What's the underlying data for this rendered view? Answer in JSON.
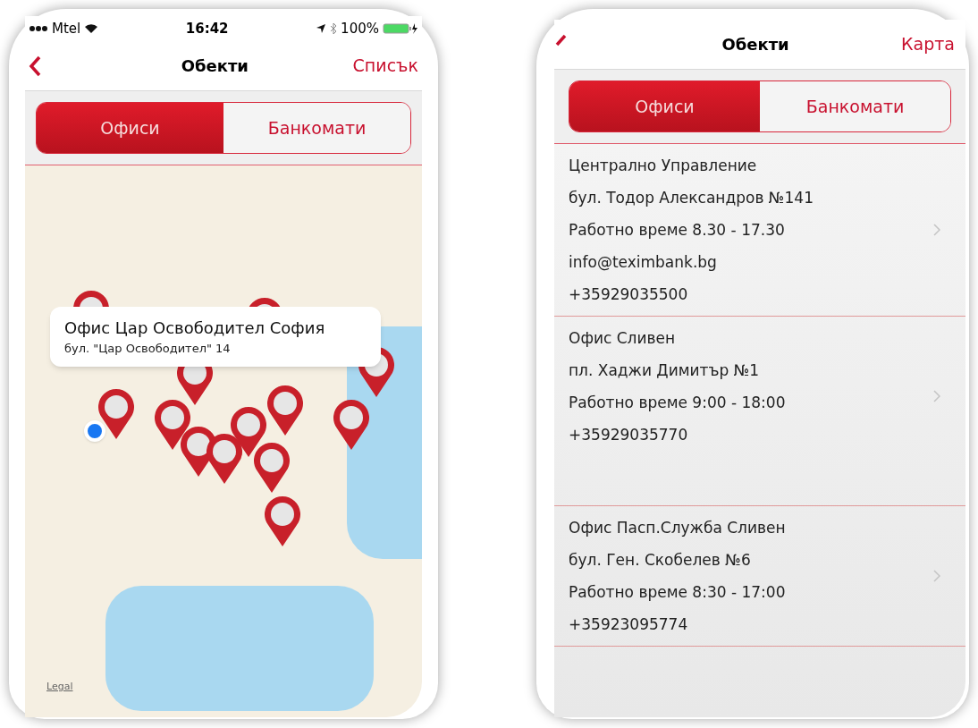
{
  "map_screen": {
    "status_bar": {
      "carrier": "Mtel",
      "time": "16:42",
      "battery": "100%"
    },
    "nav": {
      "title": "Обекти",
      "action": "Списък"
    },
    "tabs": [
      {
        "label": "Офиси",
        "selected": true
      },
      {
        "label": "Банкомати",
        "selected": false
      }
    ],
    "callout": {
      "title": "Офис Цар Освободител София",
      "subtitle": "бул. \"Цар Освободител\" 14"
    },
    "legal_link": "Legal"
  },
  "list_screen": {
    "nav": {
      "title": "Обекти",
      "action": "Карта"
    },
    "tabs": [
      {
        "label": "Офиси",
        "selected": true
      },
      {
        "label": "Банкомати",
        "selected": false
      }
    ],
    "offices": [
      {
        "lines": [
          "Централно Управление",
          "бул. Тодор Александров №141",
          "Работно време 8.30 - 17.30",
          "info@teximbank.bg",
          "+35929035500"
        ]
      },
      {
        "lines": [
          "Офис Сливен",
          "пл. Хаджи Димитър  №1",
          "Работно време 9:00 - 18:00",
          "+35929035770"
        ]
      },
      {
        "lines": [
          "Офис Пасп.Служба Сливен",
          "бул. Ген. Скобелев №6",
          "Работно време 8:30 - 17:00",
          "+35923095774"
        ]
      }
    ]
  }
}
